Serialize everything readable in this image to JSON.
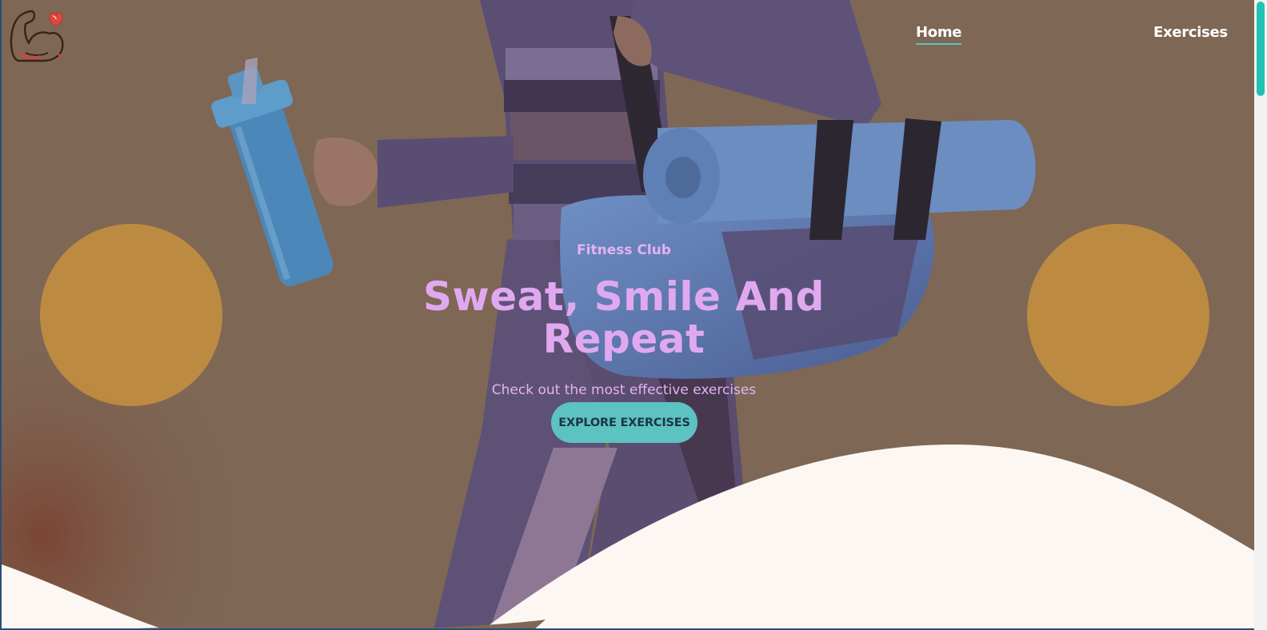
{
  "nav": {
    "home_label": "Home",
    "exercises_label": "Exercises"
  },
  "hero": {
    "eyebrow": "Fitness Club",
    "headline_line1": "Sweat, Smile And",
    "headline_line2": "Repeat",
    "subtitle": "Check out the most effective exercises",
    "cta_label": "EXPLORE EXERCISES"
  },
  "icons": {
    "logo": "flexed-arm-heart-icon"
  },
  "colors": {
    "accent": "#5cc2c2",
    "headline": "#e0a9ef",
    "circle": "#d6993b",
    "wave": "#fcf7f2",
    "overlay": "#7d6654"
  }
}
